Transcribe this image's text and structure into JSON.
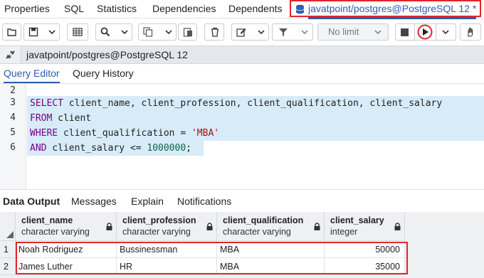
{
  "top_tabs": [
    "Properties",
    "SQL",
    "Statistics",
    "Dependencies",
    "Dependents"
  ],
  "active_tab": "javatpoint/postgres@PostgreSQL 12 *",
  "toolbar": {
    "limit_label": "No limit",
    "icons": [
      "open-file-icon",
      "save-icon",
      "grid-icon",
      "search-icon",
      "copy-icon",
      "paste-icon",
      "delete-icon",
      "edit-icon",
      "filter-icon",
      "stop-icon",
      "execute-icon",
      "explain-icon"
    ]
  },
  "connection": "javatpoint/postgres@PostgreSQL 12",
  "editor_tabs": [
    "Query Editor",
    "Query History"
  ],
  "editor": {
    "line_numbers": [
      "2",
      "3",
      "4",
      "5",
      "6"
    ],
    "lines": [
      "",
      "SELECT client_name, client_profession, client_qualification, client_salary",
      "FROM client",
      "WHERE client_qualification = 'MBA'",
      "AND client_salary <= 1000000;"
    ]
  },
  "output_tabs": [
    "Data Output",
    "Messages",
    "Explain",
    "Notifications"
  ],
  "columns": [
    {
      "name": "client_name",
      "type": "character varying"
    },
    {
      "name": "client_profession",
      "type": "character varying"
    },
    {
      "name": "client_qualification",
      "type": "character varying"
    },
    {
      "name": "client_salary",
      "type": "integer"
    }
  ],
  "rows": [
    {
      "num": "1",
      "cells": [
        "Noah Rodriguez",
        "Bussinessman",
        "MBA",
        "50000"
      ]
    },
    {
      "num": "2",
      "cells": [
        "James Luther",
        "HR",
        "MBA",
        "35000"
      ]
    }
  ],
  "colors": {
    "accent": "#2c5cb0",
    "highlight": "#e0262b",
    "keyword": "#770088",
    "string": "#aa1111",
    "number": "#116644"
  }
}
